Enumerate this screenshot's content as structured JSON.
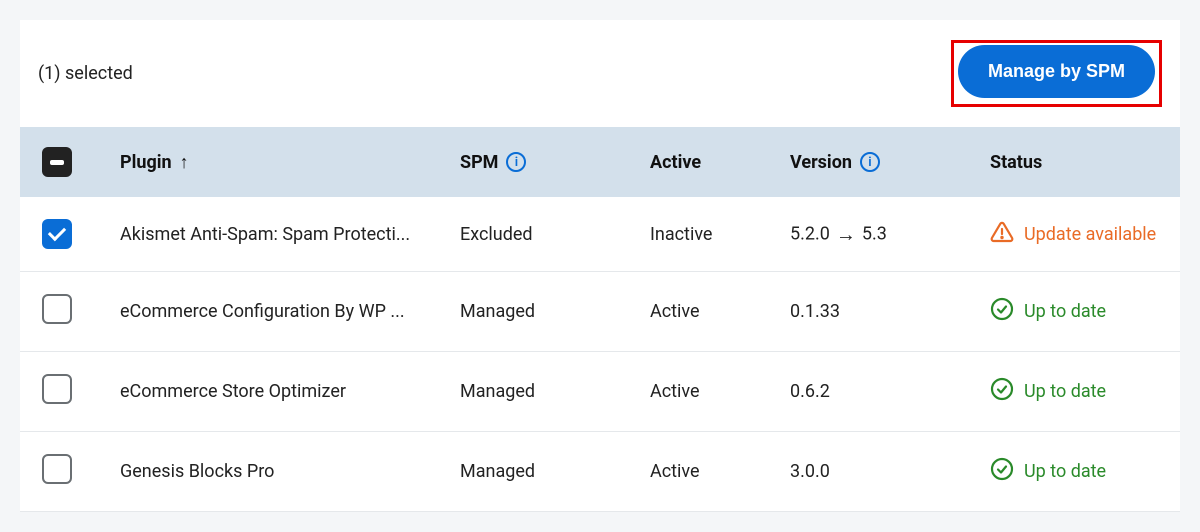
{
  "header": {
    "selected_text": "(1) selected",
    "manage_button": "Manage by SPM"
  },
  "columns": {
    "plugin": "Plugin",
    "spm": "SPM",
    "active": "Active",
    "version": "Version",
    "status": "Status"
  },
  "rows": [
    {
      "checked": true,
      "plugin": "Akismet Anti-Spam: Spam Protecti...",
      "spm": "Excluded",
      "active": "Inactive",
      "version_from": "5.2.0",
      "version_to": "5.3",
      "status_label": "Update available",
      "status_type": "update"
    },
    {
      "checked": false,
      "plugin": "eCommerce Configuration By WP ...",
      "spm": "Managed",
      "active": "Active",
      "version_from": "0.1.33",
      "version_to": "",
      "status_label": "Up to date",
      "status_type": "ok"
    },
    {
      "checked": false,
      "plugin": "eCommerce Store Optimizer",
      "spm": "Managed",
      "active": "Active",
      "version_from": "0.6.2",
      "version_to": "",
      "status_label": "Up to date",
      "status_type": "ok"
    },
    {
      "checked": false,
      "plugin": "Genesis Blocks Pro",
      "spm": "Managed",
      "active": "Active",
      "version_from": "3.0.0",
      "version_to": "",
      "status_label": "Up to date",
      "status_type": "ok"
    }
  ]
}
